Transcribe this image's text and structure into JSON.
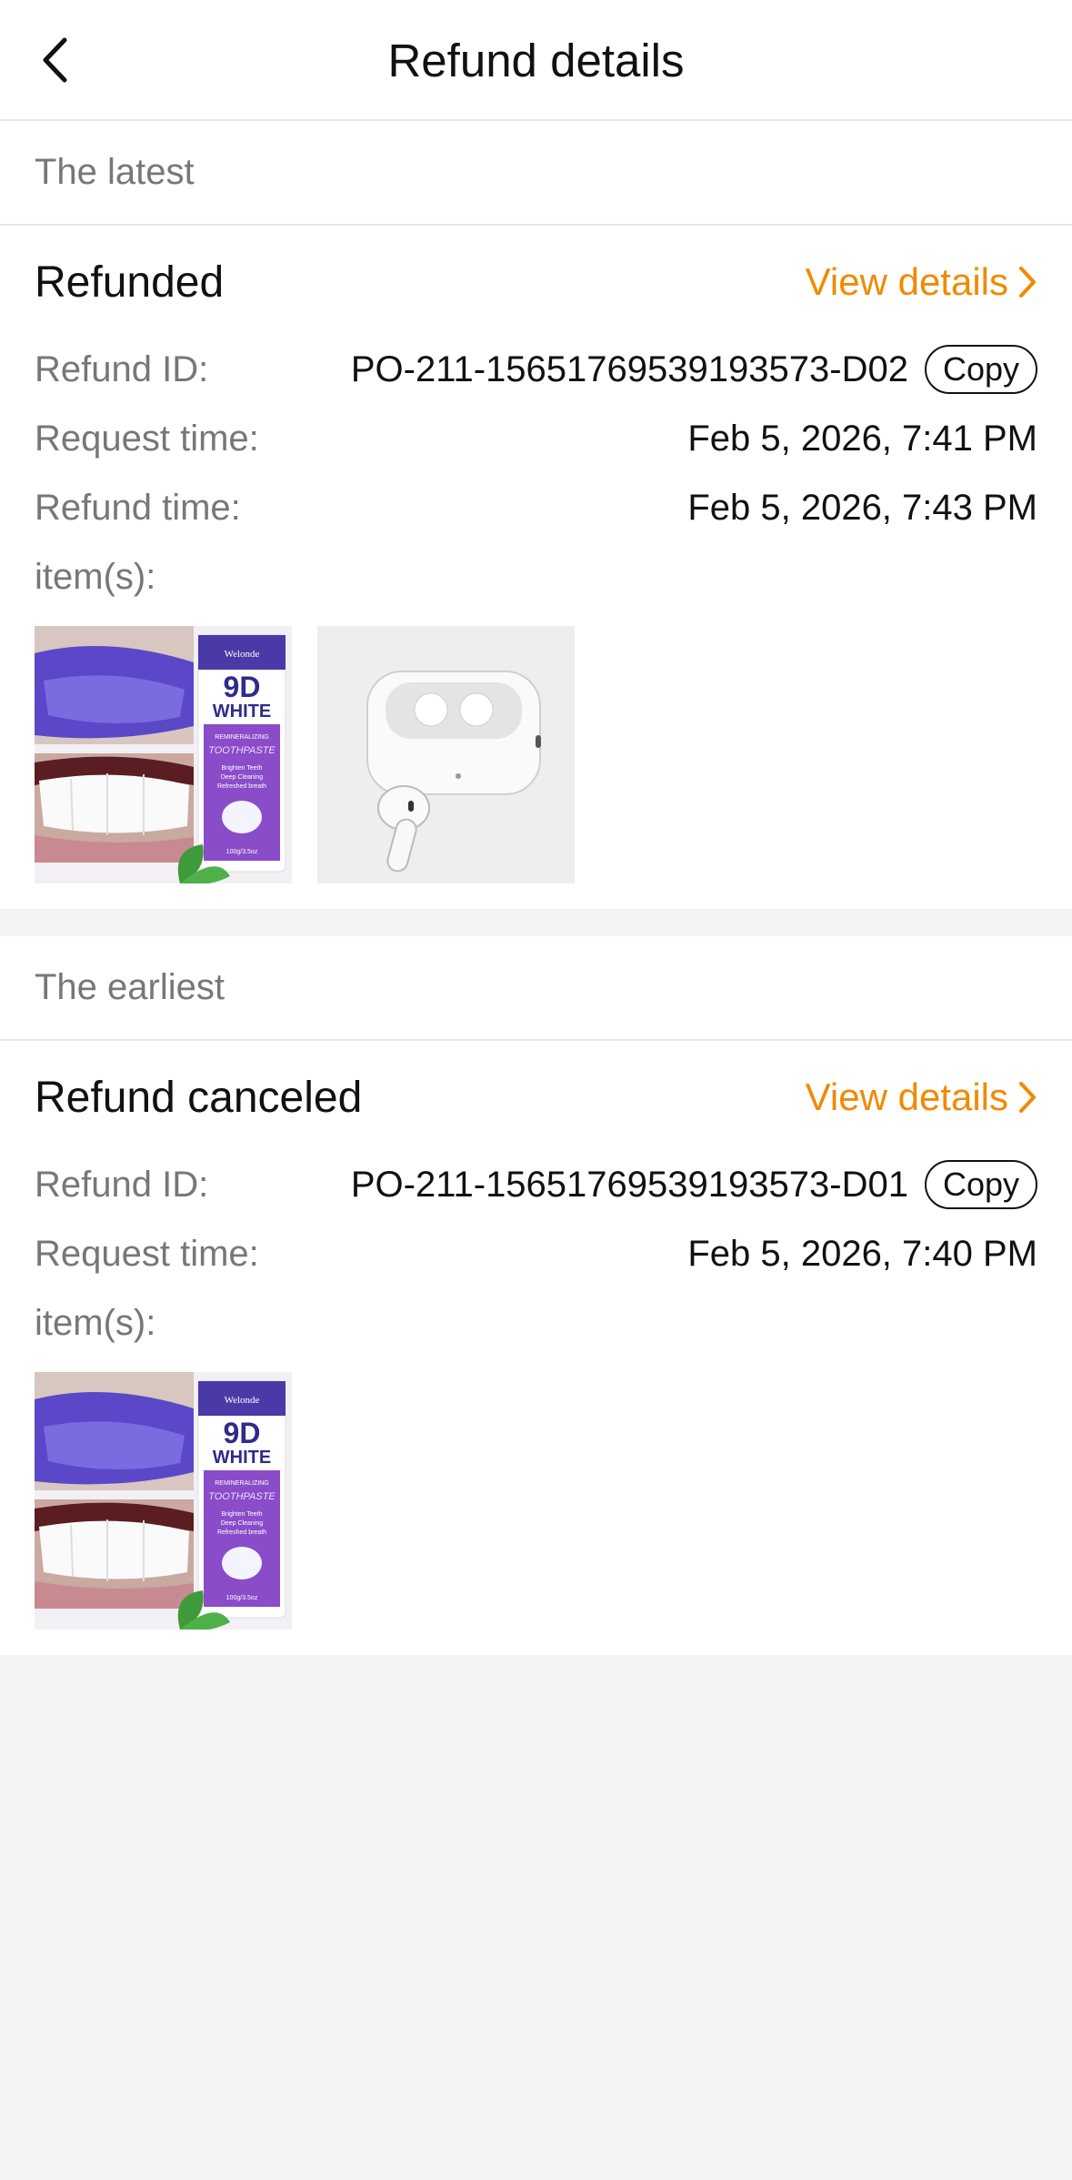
{
  "header": {
    "title": "Refund details",
    "back_icon": "chevron-left-icon"
  },
  "sections": [
    {
      "label": "The latest",
      "status": "Refunded",
      "view_details": "View details",
      "refund_id_label": "Refund ID:",
      "refund_id": "PO-211-15651769539193573-D02",
      "copy_label": "Copy",
      "request_time_label": "Request time:",
      "request_time": "Feb 5, 2026, 7:41 PM",
      "refund_time_label": "Refund time:",
      "refund_time": "Feb 5, 2026, 7:43 PM",
      "items_label": "item(s):",
      "toothpaste": {
        "brand": "Welonde",
        "name_line1": "9D",
        "name_line2": "WHITE",
        "subtitle": "REMINERALIZING",
        "type": "TOOTHPASTE",
        "bullets": [
          "Brighten Teeth",
          "Deep Cleaning",
          "Refreshed breath"
        ],
        "weight": "100g/3.5oz"
      }
    },
    {
      "label": "The earliest",
      "status": "Refund canceled",
      "view_details": "View details",
      "refund_id_label": "Refund ID:",
      "refund_id": "PO-211-15651769539193573-D01",
      "copy_label": "Copy",
      "request_time_label": "Request time:",
      "request_time": "Feb 5, 2026, 7:40 PM",
      "items_label": "item(s):",
      "toothpaste": {
        "brand": "Welonde",
        "name_line1": "9D",
        "name_line2": "WHITE",
        "subtitle": "REMINERALIZING",
        "type": "TOOTHPASTE",
        "bullets": [
          "Brighten Teeth",
          "Deep Cleaning",
          "Refreshed breath"
        ],
        "weight": "100g/3.5oz"
      }
    }
  ],
  "colors": {
    "accent": "#f08a00",
    "muted": "#777777",
    "background": "#f4f4f4"
  }
}
